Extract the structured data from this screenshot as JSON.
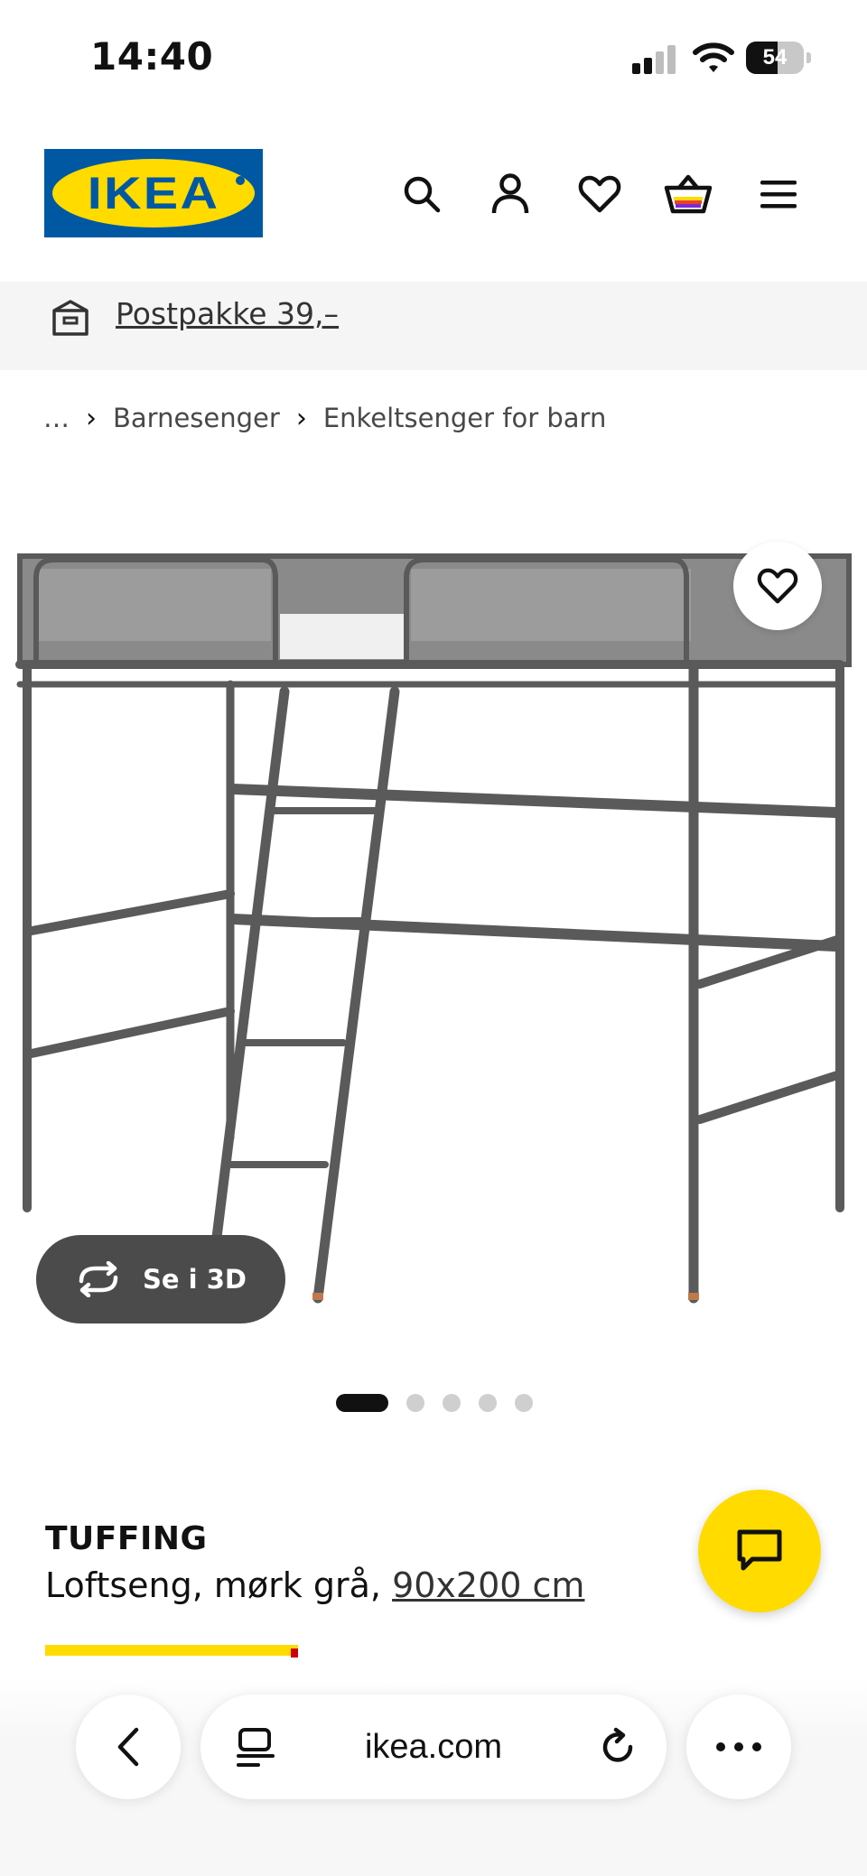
{
  "status_bar": {
    "time": "14:40",
    "battery": "54"
  },
  "header": {
    "logo_text": "IKEA"
  },
  "delivery": {
    "label": "Postpakke 39,–"
  },
  "breadcrumb": {
    "items": [
      "…",
      "Barnesenger",
      "Enkeltsenger for barn"
    ]
  },
  "product": {
    "name": "TUFFING",
    "description": "Loftseng, mørk grå, ",
    "size": "90x200 cm",
    "view_3d_label": "Se i 3D"
  },
  "carousel": {
    "image_count": 5,
    "active_index": 0
  },
  "browser": {
    "url": "ikea.com"
  },
  "colors": {
    "ikea_blue": "#0058a3",
    "ikea_yellow": "#ffdb00",
    "bed_frame": "#5a5a5a"
  }
}
